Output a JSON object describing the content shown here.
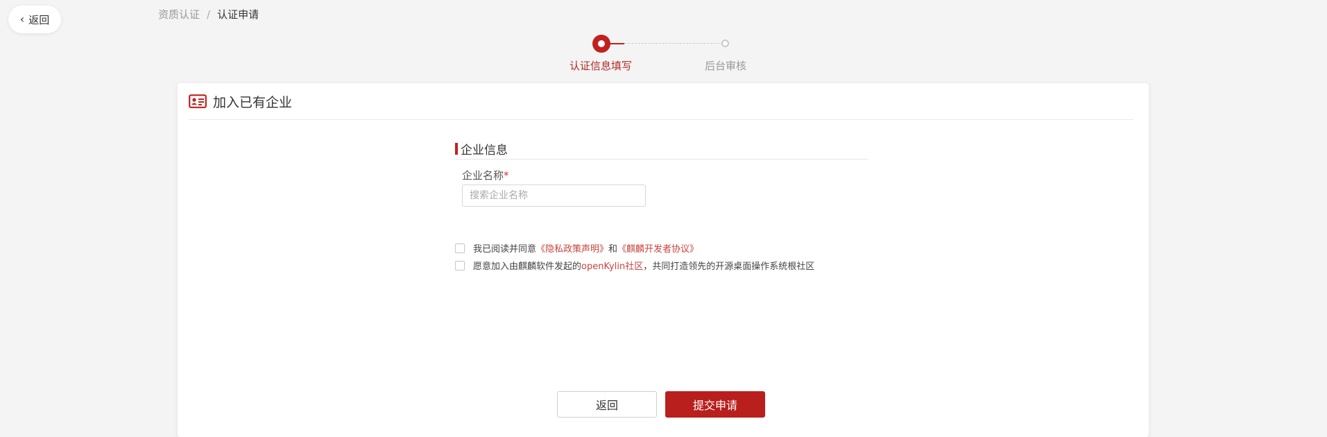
{
  "back_pill": {
    "label": "返回"
  },
  "breadcrumb": {
    "items": [
      "资质认证",
      "认证申请"
    ],
    "separator": "/"
  },
  "steps": [
    {
      "label": "认证信息填写",
      "state": "active"
    },
    {
      "label": "后台审核",
      "state": "pending"
    }
  ],
  "card": {
    "title": "加入已有企业",
    "section_title": "企业信息",
    "field": {
      "label": "企业名称",
      "required_mark": "*",
      "placeholder": "搜索企业名称",
      "value": ""
    },
    "agreements": [
      {
        "text_before": "我已阅读并同意",
        "link1": "《隐私政策声明》",
        "middle": "和",
        "link2": "《麒麟开发者协议》"
      },
      {
        "text_before": "愿意加入由麒麟软件发起的",
        "link": "openKylin社区",
        "text_after": "，共同打造领先的开源桌面操作系统根社区"
      }
    ],
    "buttons": {
      "back": "返回",
      "submit": "提交申请"
    }
  },
  "colors": {
    "accent": "#c0211e",
    "link": "#c8423c",
    "background": "#f4f4f4"
  }
}
